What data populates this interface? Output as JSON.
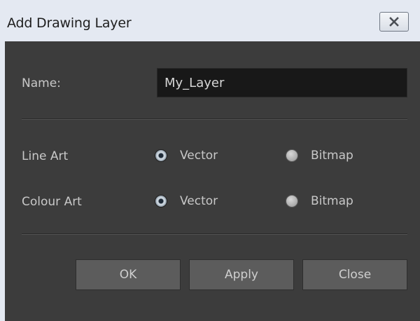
{
  "dialog": {
    "title": "Add Drawing Layer",
    "close_icon": "close-icon"
  },
  "name": {
    "label": "Name:",
    "value": "My_Layer"
  },
  "line_art": {
    "label": "Line Art",
    "options": [
      "Vector",
      "Bitmap"
    ],
    "selected": "Vector"
  },
  "colour_art": {
    "label": "Colour Art",
    "options": [
      "Vector",
      "Bitmap"
    ],
    "selected": "Vector"
  },
  "buttons": {
    "ok": "OK",
    "apply": "Apply",
    "close": "Close"
  },
  "colors": {
    "panel_bg": "#3c3c3c",
    "titlebar_bg": "#e4e9f2",
    "button_bg": "#5c5c5c",
    "field_bg": "#181818"
  }
}
